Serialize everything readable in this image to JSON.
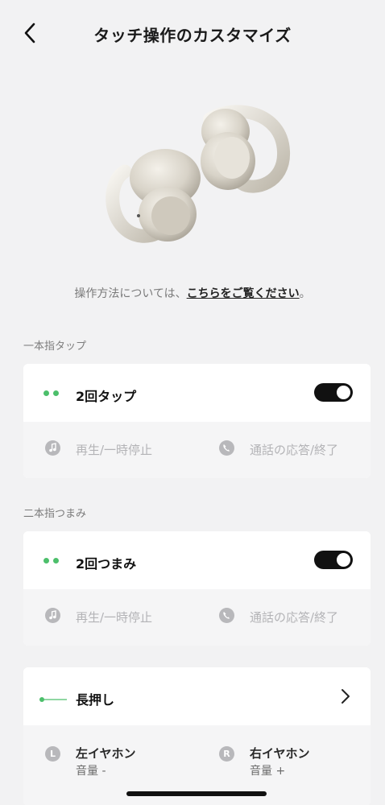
{
  "header": {
    "title": "タッチ操作のカスタマイズ",
    "back_icon": "chevron-left-icon"
  },
  "hero": {
    "image": "earbuds-product-image"
  },
  "info": {
    "prefix": "操作方法については、",
    "link": "こちらをご覧ください",
    "suffix": "。"
  },
  "sections": {
    "single": {
      "label": "一本指タップ",
      "card_title": "2回タップ",
      "toggle_on": true,
      "left_action": "再生/一時停止",
      "right_action": "通話の応答/終了"
    },
    "pinch": {
      "label": "二本指つまみ",
      "card_title": "2回つまみ",
      "toggle_on": true,
      "left_action": "再生/一時停止",
      "right_action": "通話の応答/終了"
    },
    "longpress": {
      "card_title": "長押し",
      "left": {
        "badge": "L",
        "name": "左イヤホン",
        "value": "音量 -"
      },
      "right": {
        "badge": "R",
        "name": "右イヤホン",
        "value": "音量 +"
      }
    }
  },
  "colors": {
    "accent_green": "#4cbf6b",
    "toggle_on": "#111111",
    "background": "#f2f2f3"
  }
}
